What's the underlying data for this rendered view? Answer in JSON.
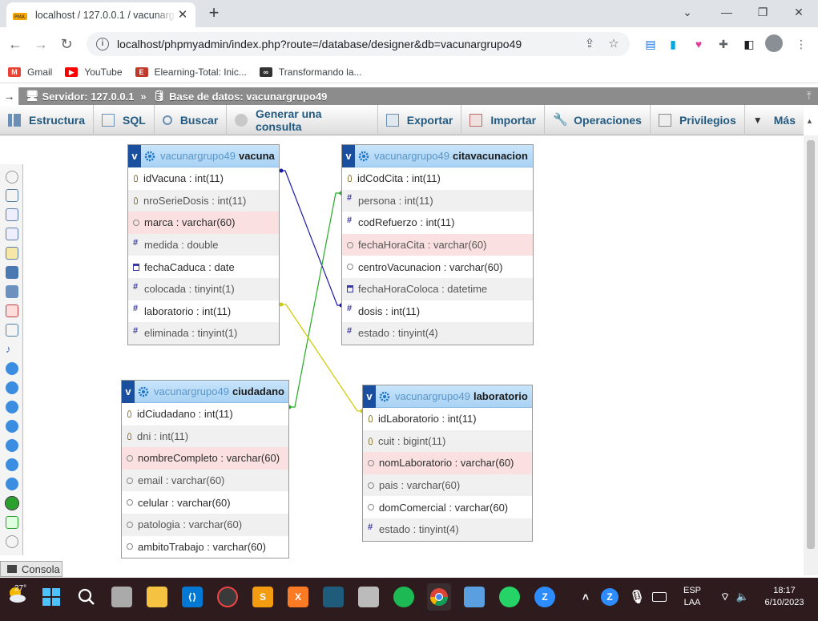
{
  "browser": {
    "tab_title": "localhost / 127.0.0.1 / vacunargrupo49",
    "tab_close": "✕",
    "new_tab": "+",
    "url": "localhost/phpmyadmin/index.php?route=/database/designer&db=vacunargrupo49",
    "window_controls": {
      "minimize": "⌄",
      "restore": "—",
      "maximize": "❐",
      "close": "✕"
    }
  },
  "bookmarks": [
    {
      "label": "Gmail",
      "icon": "gmail-icon",
      "color": "#ea4335",
      "glyph": "M"
    },
    {
      "label": "YouTube",
      "icon": "youtube-icon",
      "color": "#ff0000",
      "glyph": "▶"
    },
    {
      "label": "Elearning-Total: Inic...",
      "icon": "elearning-icon",
      "color": "#c0392b",
      "glyph": "E"
    },
    {
      "label": "Transformando la...",
      "icon": "transformando-icon",
      "color": "#333333",
      "glyph": "∞"
    }
  ],
  "pma": {
    "breadcrumb_server": "Servidor: 127.0.0.1",
    "breadcrumb_sep": "»",
    "breadcrumb_db": "Base de datos: vacunargrupo49",
    "menu": [
      {
        "label": "Estructura",
        "icon": "structure-icon"
      },
      {
        "label": "SQL",
        "icon": "sql-icon"
      },
      {
        "label": "Buscar",
        "icon": "search-icon"
      },
      {
        "label": "Generar una consulta",
        "icon": "query-icon"
      },
      {
        "label": "Exportar",
        "icon": "export-icon"
      },
      {
        "label": "Importar",
        "icon": "import-icon"
      },
      {
        "label": "Operaciones",
        "icon": "wrench-icon"
      },
      {
        "label": "Privilegios",
        "icon": "privileges-icon"
      },
      {
        "label": "Más",
        "icon": "more-icon"
      }
    ],
    "console_label": "Consola"
  },
  "designer": {
    "db_prefix": "vacunargrupo49",
    "tables": [
      {
        "name": "vacuna",
        "columns": [
          {
            "name": "idVacuna",
            "type": "int(11)",
            "kind": "key",
            "bold": true
          },
          {
            "name": "nroSerieDosis",
            "type": "int(11)",
            "kind": "key",
            "bold": false
          },
          {
            "name": "marca",
            "type": "varchar(60)",
            "kind": "str",
            "bold": true,
            "highlight": "pink"
          },
          {
            "name": "medida",
            "type": "double",
            "kind": "num",
            "bold": false
          },
          {
            "name": "fechaCaduca",
            "type": "date",
            "kind": "date",
            "bold": true
          },
          {
            "name": "colocada",
            "type": "tinyint(1)",
            "kind": "num",
            "bold": false
          },
          {
            "name": "laboratorio",
            "type": "int(11)",
            "kind": "num",
            "bold": true
          },
          {
            "name": "eliminada",
            "type": "tinyint(1)",
            "kind": "num",
            "bold": false
          }
        ]
      },
      {
        "name": "citavacunacion",
        "columns": [
          {
            "name": "idCodCita",
            "type": "int(11)",
            "kind": "key",
            "bold": true
          },
          {
            "name": "persona",
            "type": "int(11)",
            "kind": "num",
            "bold": false
          },
          {
            "name": "codRefuerzo",
            "type": "int(11)",
            "kind": "num",
            "bold": true
          },
          {
            "name": "fechaHoraCita",
            "type": "varchar(60)",
            "kind": "str",
            "bold": false,
            "highlight": "pink"
          },
          {
            "name": "centroVacunacion",
            "type": "varchar(60)",
            "kind": "str",
            "bold": true
          },
          {
            "name": "fechaHoraColoca",
            "type": "datetime",
            "kind": "date",
            "bold": false
          },
          {
            "name": "dosis",
            "type": "int(11)",
            "kind": "num",
            "bold": true
          },
          {
            "name": "estado",
            "type": "tinyint(4)",
            "kind": "num",
            "bold": false
          }
        ]
      },
      {
        "name": "ciudadano",
        "columns": [
          {
            "name": "idCiudadano",
            "type": "int(11)",
            "kind": "key",
            "bold": true
          },
          {
            "name": "dni",
            "type": "int(11)",
            "kind": "key",
            "bold": false
          },
          {
            "name": "nombreCompleto",
            "type": "varchar(60)",
            "kind": "str",
            "bold": true,
            "highlight": "pink"
          },
          {
            "name": "email",
            "type": "varchar(60)",
            "kind": "str",
            "bold": false
          },
          {
            "name": "celular",
            "type": "varchar(60)",
            "kind": "str",
            "bold": true
          },
          {
            "name": "patologia",
            "type": "varchar(60)",
            "kind": "str",
            "bold": false
          },
          {
            "name": "ambitoTrabajo",
            "type": "varchar(60)",
            "kind": "str",
            "bold": true
          }
        ]
      },
      {
        "name": "laboratorio",
        "columns": [
          {
            "name": "idLaboratorio",
            "type": "int(11)",
            "kind": "key",
            "bold": true
          },
          {
            "name": "cuit",
            "type": "bigint(11)",
            "kind": "key",
            "bold": false
          },
          {
            "name": "nomLaboratorio",
            "type": "varchar(60)",
            "kind": "str",
            "bold": true,
            "highlight": "pink"
          },
          {
            "name": "pais",
            "type": "varchar(60)",
            "kind": "str",
            "bold": false
          },
          {
            "name": "domComercial",
            "type": "varchar(60)",
            "kind": "str",
            "bold": true
          },
          {
            "name": "estado",
            "type": "tinyint(4)",
            "kind": "num",
            "bold": false
          }
        ]
      }
    ],
    "relations": [
      {
        "from": "citavacunacion.dosis",
        "to": "vacuna.idVacuna",
        "color": "#1a1aa8"
      },
      {
        "from": "citavacunacion.persona",
        "to": "ciudadano.idCiudadano",
        "color": "#22aa22"
      },
      {
        "from": "vacuna.laboratorio",
        "to": "laboratorio.idLaboratorio",
        "color": "#cccc00"
      }
    ]
  },
  "taskbar": {
    "weather_temp": "27°",
    "lang_line1": "ESP",
    "lang_line2": "LAA",
    "time": "18:17",
    "date": "6/10/2023"
  }
}
